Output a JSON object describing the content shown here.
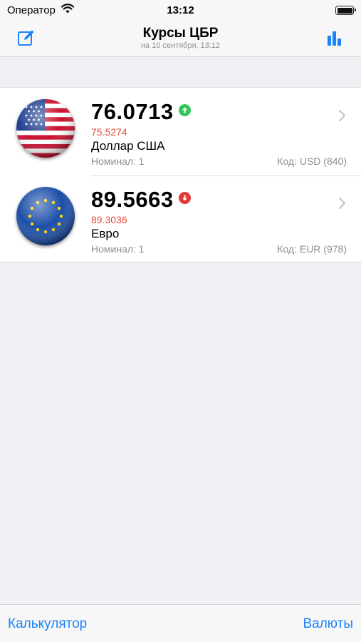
{
  "status_bar": {
    "carrier": "Оператор",
    "time": "13:12"
  },
  "nav": {
    "title": "Курсы ЦБР",
    "subtitle": "на 10 сентября, 13:12",
    "left_icon": "compose-icon",
    "right_icon": "bar-chart-icon"
  },
  "currencies": [
    {
      "rate": "76.0713",
      "previous": "75.5274",
      "name": "Доллар США",
      "nominal": "Номинал: 1",
      "code": "Код: USD (840)",
      "trend": "up",
      "flag": "us-flag-icon"
    },
    {
      "rate": "89.5663",
      "previous": "89.3036",
      "name": "Евро",
      "nominal": "Номинал: 1",
      "code": "Код: EUR (978)",
      "trend": "down",
      "flag": "eu-flag-icon"
    }
  ],
  "toolbar": {
    "calculator_label": "Калькулятор",
    "currencies_label": "Валюты"
  },
  "colors": {
    "accent": "#1a82fb",
    "up": "#34c759",
    "down": "#e53935",
    "previous": "#e74c3c"
  }
}
